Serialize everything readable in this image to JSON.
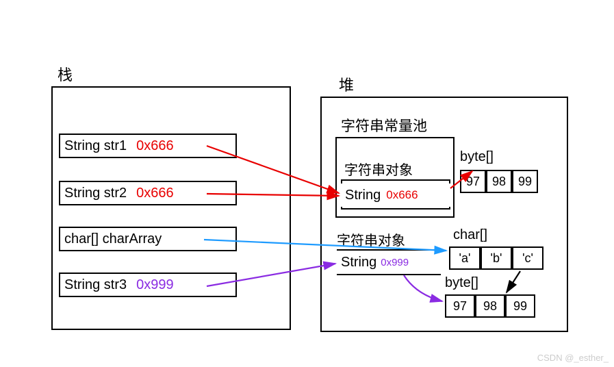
{
  "titles": {
    "stack": "栈",
    "heap": "堆",
    "constantPool": "字符串常量池",
    "stringObj1": "字符串对象",
    "stringType1": "String",
    "addr1": "0x666",
    "byteArr1": "byte[]",
    "byteVals1": [
      "97",
      "98",
      "99"
    ],
    "stringObj2": "字符串对象",
    "stringType2": "String",
    "addr2": "0x999",
    "charArr": "char[]",
    "charVals": [
      "'a'",
      "'b'",
      "'c'"
    ],
    "byteArr2": "byte[]",
    "byteVals2": [
      "97",
      "98",
      "99"
    ]
  },
  "stack": {
    "row1_label": "String str1",
    "row1_addr": "0x666",
    "row2_label": "String str2",
    "row2_addr": "0x666",
    "row3_label": "char[] charArray",
    "row4_label": "String str3",
    "row4_addr": "0x999"
  },
  "watermark": "CSDN @_esther_",
  "colors": {
    "red": "#e80000",
    "blue": "#1e9bff",
    "purple": "#8a2be2",
    "black": "#000"
  }
}
